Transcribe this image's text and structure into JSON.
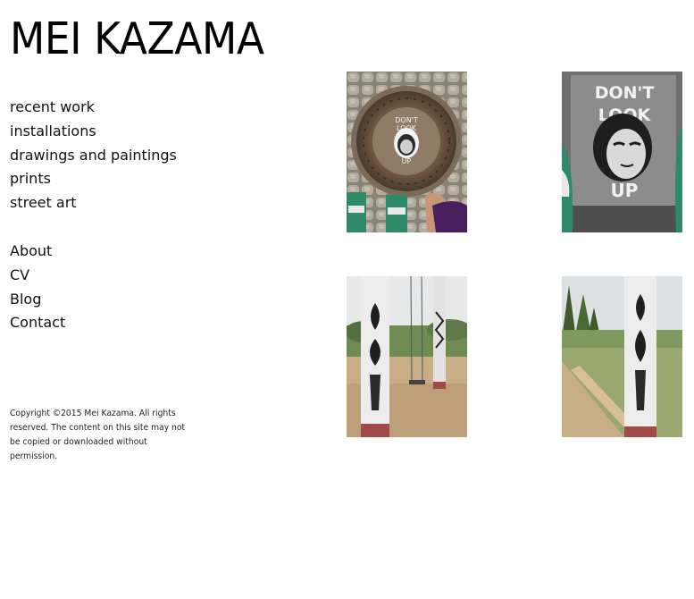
{
  "site": {
    "title": "MEI KAZAMA"
  },
  "nav": {
    "work_items": [
      {
        "label": "recent work"
      },
      {
        "label": "installations"
      },
      {
        "label": "drawings and paintings"
      },
      {
        "label": "prints"
      },
      {
        "label": "street art"
      }
    ],
    "info_items": [
      {
        "label": "About"
      },
      {
        "label": "CV"
      },
      {
        "label": "Blog"
      },
      {
        "label": "Contact"
      }
    ]
  },
  "footer": {
    "copyright": "Copyright ©2015 Mei Kazama. All rights reserved. The content on this site may not be copied or downloaded without permission."
  },
  "gallery": {
    "images": [
      {
        "stencil_text": [
          "DON'T",
          "LOOK",
          "UP"
        ]
      },
      {
        "stencil_text": [
          "DON'T",
          "LOOK",
          "UP"
        ]
      },
      {},
      {}
    ]
  },
  "colors": {
    "text": "#111111",
    "background": "#ffffff"
  }
}
